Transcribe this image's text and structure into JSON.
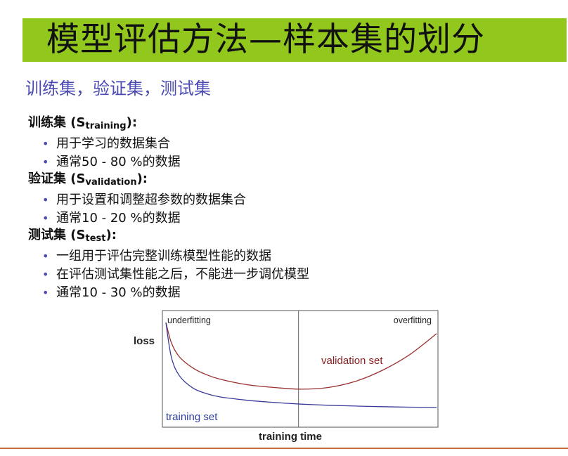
{
  "slide": {
    "title": "模型评估方法—样本集的划分",
    "subtitle": "训练集，验证集，测试集",
    "colors": {
      "banner": "#92c81e",
      "accent": "#4b4bb4",
      "training_curve": "#3a3a9a",
      "validation_curve": "#9a3030",
      "validation_label": "#8b1a1a",
      "training_label": "#2f3f9f",
      "rule": "#c0703a"
    }
  },
  "sections": [
    {
      "heading": "训练集",
      "symbol": "S",
      "subscript": "training",
      "bullets": [
        "用于学习的数据集合",
        "通常50 - 80 %的数据"
      ]
    },
    {
      "heading": "验证集",
      "symbol": "S",
      "subscript": "validation",
      "bullets": [
        "用于设置和调整超参数的数据集合",
        "通常10 - 20 %的数据"
      ]
    },
    {
      "heading": "测试集",
      "symbol": "S",
      "subscript": "test",
      "bullets": [
        "一组用于评估完整训练模型性能的数据",
        "在评估测试集性能之后，不能进一步调优模型",
        "通常10 - 30 %的数据"
      ]
    }
  ],
  "chart_data": {
    "type": "line",
    "xlabel": "training time",
    "ylabel": "loss",
    "xlim": [
      0,
      1
    ],
    "ylim": [
      0,
      1
    ],
    "grid": false,
    "annotations": [
      {
        "text": "underfitting",
        "position": "top-left"
      },
      {
        "text": "overfitting",
        "position": "top-right"
      }
    ],
    "divider_x": 0.49,
    "series": [
      {
        "name": "training set",
        "x": [
          0.0,
          0.02,
          0.05,
          0.1,
          0.15,
          0.2,
          0.3,
          0.4,
          0.5,
          0.6,
          0.7,
          0.8,
          0.9,
          1.0
        ],
        "y": [
          0.93,
          0.62,
          0.45,
          0.34,
          0.29,
          0.26,
          0.23,
          0.21,
          0.195,
          0.185,
          0.178,
          0.172,
          0.168,
          0.165
        ]
      },
      {
        "name": "validation set",
        "x": [
          0.0,
          0.02,
          0.05,
          0.1,
          0.15,
          0.2,
          0.3,
          0.4,
          0.5,
          0.6,
          0.7,
          0.8,
          0.9,
          1.0
        ],
        "y": [
          0.93,
          0.75,
          0.62,
          0.52,
          0.46,
          0.42,
          0.37,
          0.345,
          0.33,
          0.345,
          0.4,
          0.5,
          0.64,
          0.83
        ]
      }
    ]
  }
}
